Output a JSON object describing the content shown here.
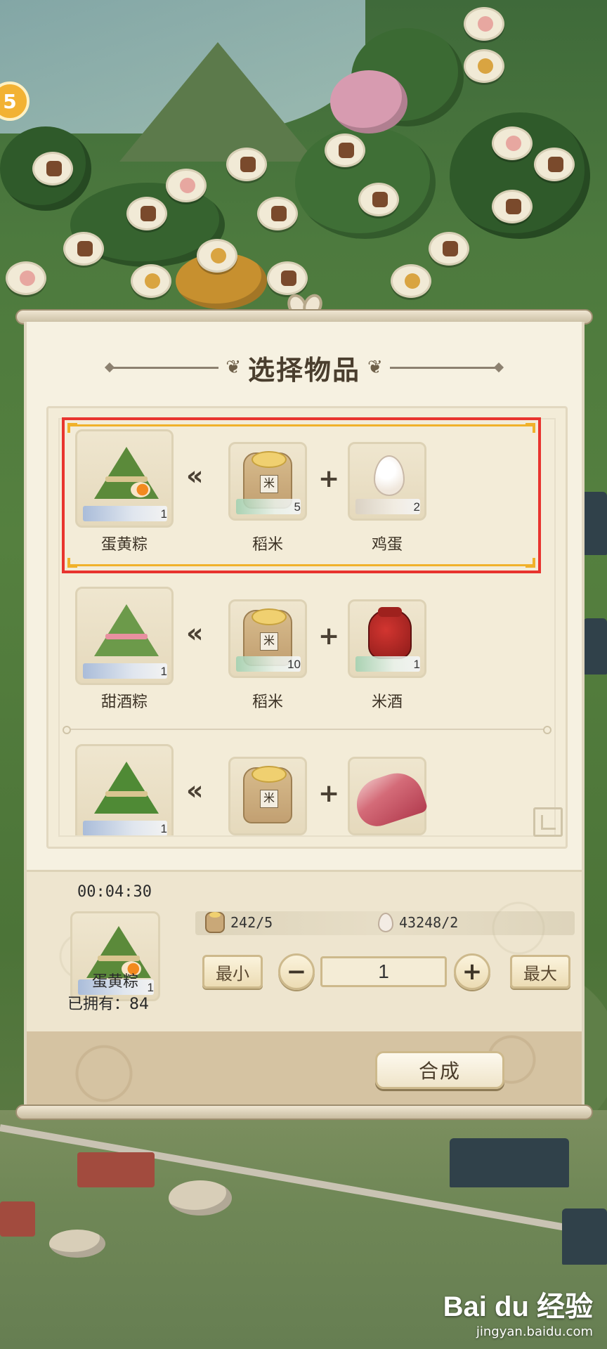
{
  "dialog": {
    "title": "选择物品"
  },
  "recipes": [
    {
      "result": {
        "name": "蛋黄粽",
        "count": "1",
        "icon": "egg-yolk-zongzi-icon"
      },
      "ingredients": [
        {
          "name": "稻米",
          "count": "5",
          "icon": "rice-sack-icon"
        },
        {
          "name": "鸡蛋",
          "count": "2",
          "icon": "egg-icon"
        }
      ],
      "selected": true
    },
    {
      "result": {
        "name": "甜酒粽",
        "count": "1",
        "icon": "sweet-wine-zongzi-icon"
      },
      "ingredients": [
        {
          "name": "稻米",
          "count": "10",
          "icon": "rice-sack-icon"
        },
        {
          "name": "米酒",
          "count": "1",
          "icon": "rice-wine-jar-icon"
        }
      ],
      "selected": false
    },
    {
      "result": {
        "name": "",
        "count": "1",
        "icon": "meat-zongzi-icon"
      },
      "ingredients": [
        {
          "name": "",
          "count": "",
          "icon": "rice-sack-icon"
        },
        {
          "name": "",
          "count": "",
          "icon": "pork-icon"
        }
      ],
      "selected": false
    }
  ],
  "craft": {
    "timer": "00:04:30",
    "item_name": "蛋黄粽",
    "item_count": "1",
    "owned_label": "已拥有：84",
    "materials": [
      {
        "text": "242/5",
        "icon": "rice-sack-icon"
      },
      {
        "text": "43248/2",
        "icon": "egg-icon"
      }
    ],
    "min_label": "最小",
    "max_label": "最大",
    "minus_label": "−",
    "plus_label": "+",
    "quantity": "1",
    "synth_label": "合成"
  },
  "watermark": {
    "logo": "Bai du 经验",
    "url": "jingyan.baidu.com"
  },
  "side_button": {
    "label": "5"
  },
  "colors": {
    "selection_border": "#e8342e",
    "selection_corner": "#f0b12a",
    "panel_bg": "#f6f1e1"
  }
}
